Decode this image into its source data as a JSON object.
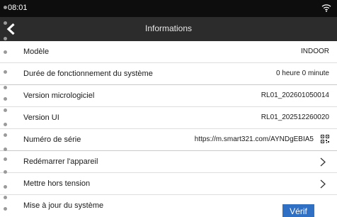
{
  "status_bar": {
    "time": "08:01"
  },
  "header": {
    "title": "Informations"
  },
  "rows": [
    {
      "label": "Modèle",
      "value": "INDOOR"
    },
    {
      "label": "Durée de fonctionnement du système",
      "value": "0 heure 0 minute"
    },
    {
      "label": "Version micrologiciel",
      "value": "RL01_202601050014"
    },
    {
      "label": "Version UI",
      "value": "RL01_202512260020"
    },
    {
      "label": "Numéro de série",
      "value": "https://m.smart321.com/AYNDgEBIA5"
    },
    {
      "label": "Redémarrer l'appareil"
    },
    {
      "label": "Mettre hors tension"
    },
    {
      "label": "Mise à jour du système",
      "button": "Vérif"
    }
  ],
  "colors": {
    "status_bg": "#0d0d0d",
    "header_bg": "#2c2c2c",
    "accent": "#2f6fc4"
  }
}
